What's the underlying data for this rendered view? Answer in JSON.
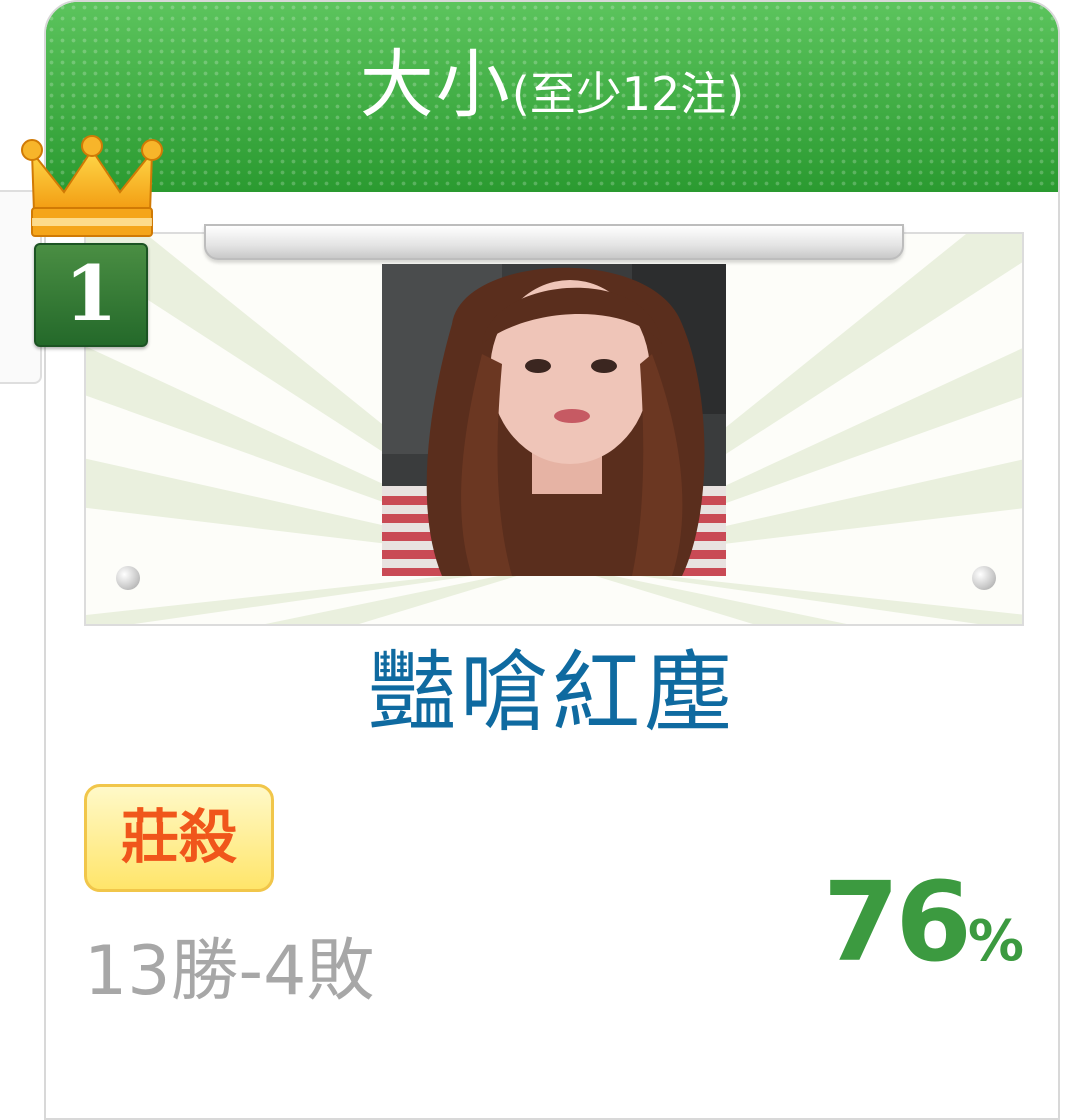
{
  "card": {
    "title_main": "大小",
    "title_sub": "(至少12注)",
    "rank": "1",
    "player_name": "豔嗆紅塵",
    "badge_label": "莊殺",
    "record": "13勝-4敗",
    "win_rate_value": "76",
    "win_rate_unit": "%"
  },
  "icons": [
    "crown-icon",
    "rank-badge",
    "avatar"
  ],
  "colors": {
    "header_green": "#35a93a",
    "name_blue": "#0f6aa0",
    "win_rate_green": "#3c9a40",
    "badge_orange": "#f0561b",
    "record_gray": "#a7a7a7"
  }
}
